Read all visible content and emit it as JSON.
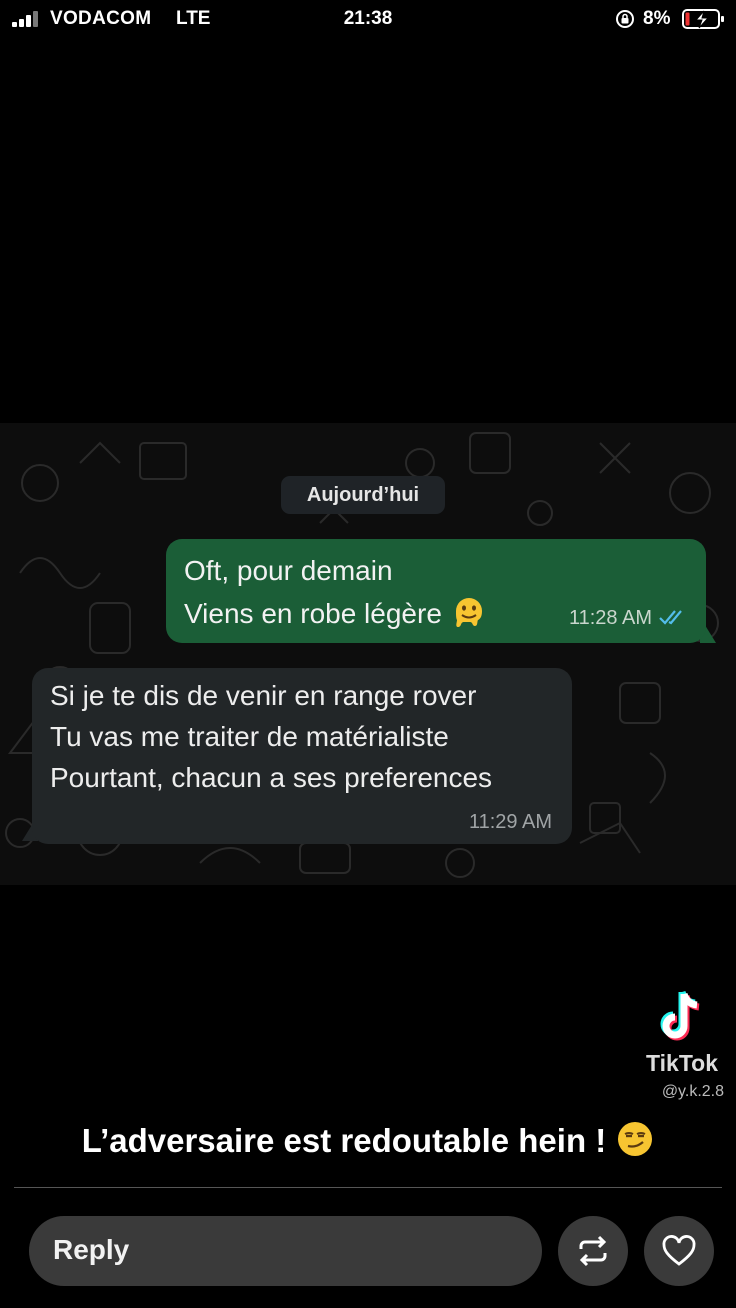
{
  "status_bar": {
    "carrier": "VODACOM",
    "network": "LTE",
    "time": "21:38",
    "battery": "8%"
  },
  "chat": {
    "date_label": "Aujourd’hui",
    "messages": [
      {
        "direction": "outgoing",
        "lines": [
          "Oft, pour demain",
          "Viens en robe légère"
        ],
        "emoji": "melting-face",
        "time": "11:28 AM",
        "status": "read"
      },
      {
        "direction": "incoming",
        "lines": [
          "Si je te dis de venir en range rover",
          "Tu vas me traiter de matérialiste",
          "Pourtant, chacun a ses preferences"
        ],
        "time": "11:29 AM"
      }
    ]
  },
  "watermark": {
    "brand": "TikTok",
    "user": "@y.k.2.8"
  },
  "caption": {
    "text": "L’adversaire est redoutable hein !",
    "emoji": "smirking-face"
  },
  "reply_bar": {
    "placeholder": "Reply",
    "share_icon": "repost-icon",
    "like_icon": "heart-icon"
  },
  "colors": {
    "outgoing_bubble": "#1b5e37",
    "incoming_bubble": "#222628",
    "read_ticks": "#53bdeb"
  }
}
